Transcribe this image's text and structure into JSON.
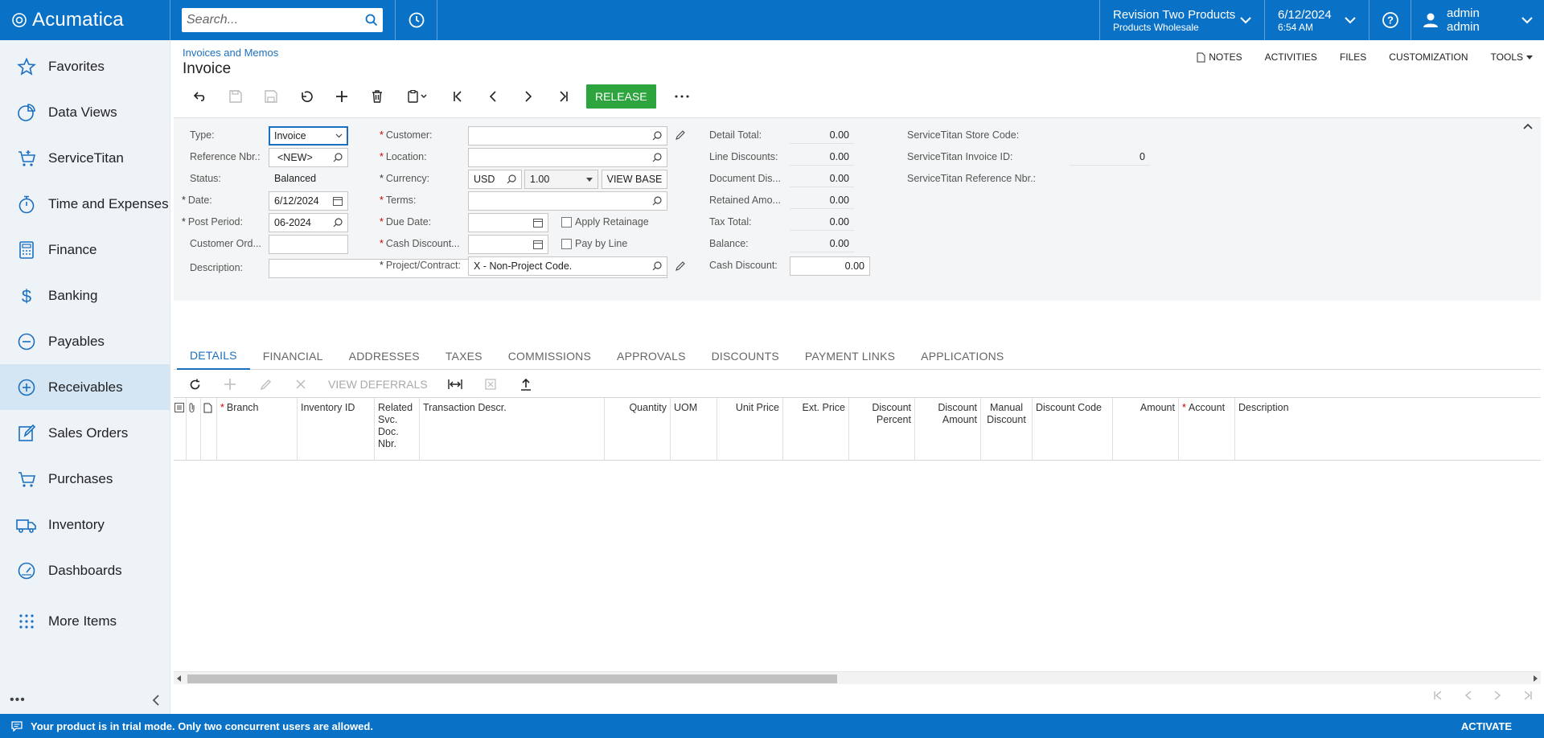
{
  "header": {
    "logo_text": "Acumatica",
    "search_placeholder": "Search...",
    "company_name": "Revision Two Products",
    "branch_name": "Products Wholesale",
    "date": "6/12/2024",
    "time": "6:54 AM",
    "user_name": "admin admin",
    "brand_color": "#0a72c6"
  },
  "sidebar": {
    "items": [
      {
        "label": "Favorites",
        "icon": "star-icon"
      },
      {
        "label": "Data Views",
        "icon": "pie-chart-icon"
      },
      {
        "label": "ServiceTitan",
        "icon": "cart-plus-icon"
      },
      {
        "label": "Time and Expenses",
        "icon": "stopwatch-icon"
      },
      {
        "label": "Finance",
        "icon": "calculator-icon"
      },
      {
        "label": "Banking",
        "icon": "dollar-icon"
      },
      {
        "label": "Payables",
        "icon": "minus-circle-icon"
      },
      {
        "label": "Receivables",
        "icon": "plus-circle-icon"
      },
      {
        "label": "Sales Orders",
        "icon": "edit-icon"
      },
      {
        "label": "Purchases",
        "icon": "cart-icon"
      },
      {
        "label": "Inventory",
        "icon": "truck-icon"
      },
      {
        "label": "Dashboards",
        "icon": "gauge-icon"
      },
      {
        "label": "More Items",
        "icon": "grid-dots-icon"
      }
    ],
    "active": "Receivables"
  },
  "page": {
    "breadcrumb": "Invoices and Memos",
    "title": "Invoice",
    "links": [
      "NOTES",
      "ACTIVITIES",
      "FILES",
      "CUSTOMIZATION",
      "TOOLS"
    ],
    "release_label": "RELEASE",
    "release_color": "#2ea43e"
  },
  "form": {
    "type_label": "Type:",
    "type_value": "Invoice",
    "refnbr_label": "Reference Nbr.:",
    "refnbr_value": "<NEW>",
    "status_label": "Status:",
    "status_value": "Balanced",
    "date_label": "Date:",
    "date_value": "6/12/2024",
    "postperiod_label": "Post Period:",
    "postperiod_value": "06-2024",
    "customerord_label": "Customer Ord...",
    "description_label": "Description:",
    "customer_label": "Customer:",
    "location_label": "Location:",
    "currency_label": "Currency:",
    "currency_value": "USD",
    "rate_value": "1.00",
    "view_base_label": "VIEW BASE",
    "terms_label": "Terms:",
    "duedate_label": "Due Date:",
    "cashdiscount_date_label": "Cash Discount...",
    "project_label": "Project/Contract:",
    "project_value": "X - Non-Project Code.",
    "apply_retainage_label": "Apply Retainage",
    "pay_by_line_label": "Pay by Line",
    "totals": [
      {
        "label": "Detail Total:",
        "value": "0.00"
      },
      {
        "label": "Line Discounts:",
        "value": "0.00"
      },
      {
        "label": "Document Dis...",
        "value": "0.00"
      },
      {
        "label": "Retained Amo...",
        "value": "0.00"
      },
      {
        "label": "Tax Total:",
        "value": "0.00"
      },
      {
        "label": "Balance:",
        "value": "0.00"
      },
      {
        "label": "Cash Discount:",
        "value": "0.00"
      }
    ],
    "st_store_label": "ServiceTitan Store Code:",
    "st_invoice_label": "ServiceTitan Invoice ID:",
    "st_invoice_value": "0",
    "st_ref_label": "ServiceTitan Reference Nbr.:"
  },
  "tabs": [
    "DETAILS",
    "FINANCIAL",
    "ADDRESSES",
    "TAXES",
    "COMMISSIONS",
    "APPROVALS",
    "DISCOUNTS",
    "PAYMENT LINKS",
    "APPLICATIONS"
  ],
  "grid_toolbar": {
    "view_deferrals": "VIEW DEFERRALS"
  },
  "grid": {
    "columns": [
      "Branch",
      "Inventory ID",
      "Related Svc. Doc. Nbr.",
      "Transaction Descr.",
      "Quantity",
      "UOM",
      "Unit Price",
      "Ext. Price",
      "Discount Percent",
      "Discount Amount",
      "Manual Discount",
      "Discount Code",
      "Amount",
      "Account",
      "Description"
    ]
  },
  "statusbar": {
    "message": "Your product is in trial mode. Only two concurrent users are allowed.",
    "activate": "ACTIVATE"
  }
}
